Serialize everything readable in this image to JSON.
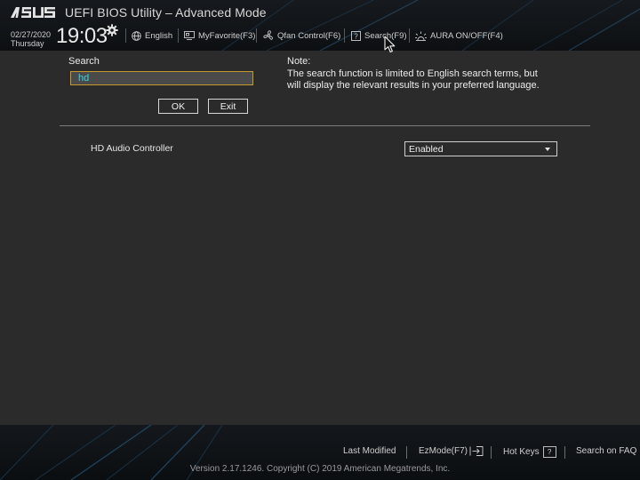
{
  "header": {
    "title": "UEFI BIOS Utility – Advanced Mode",
    "date": "02/27/2020",
    "weekday": "Thursday",
    "time": "19:03",
    "tools": [
      {
        "label": "English",
        "icon": "globe-icon"
      },
      {
        "label": "MyFavorite(F3)",
        "icon": "monitor-icon"
      },
      {
        "label": "Qfan Control(F6)",
        "icon": "fan-icon"
      },
      {
        "label": "Search(F9)",
        "icon": "question-icon"
      },
      {
        "label": "AURA ON/OFF(F4)",
        "icon": "aura-icon"
      }
    ]
  },
  "search": {
    "label": "Search",
    "value": "hd",
    "ok_label": "OK",
    "exit_label": "Exit"
  },
  "note": {
    "title": "Note:",
    "line1": "The search function is limited to English search terms, but",
    "line2": "will display the relevant results in your preferred language."
  },
  "results": [
    {
      "label": "HD Audio Controller",
      "value": "Enabled"
    }
  ],
  "footer": {
    "last_modified": "Last Modified",
    "ezmode": "EzMode(F7)",
    "hotkeys": "Hot Keys",
    "hotkeys_key": "?",
    "search_faq": "Search on FAQ",
    "copyright": "Version 2.17.1246. Copyright (C) 2019 American Megatrends, Inc."
  },
  "colors": {
    "background": "#2b2b2b",
    "header": "#111417",
    "input_border": "#c69a2d",
    "input_text": "#34d7e3"
  }
}
